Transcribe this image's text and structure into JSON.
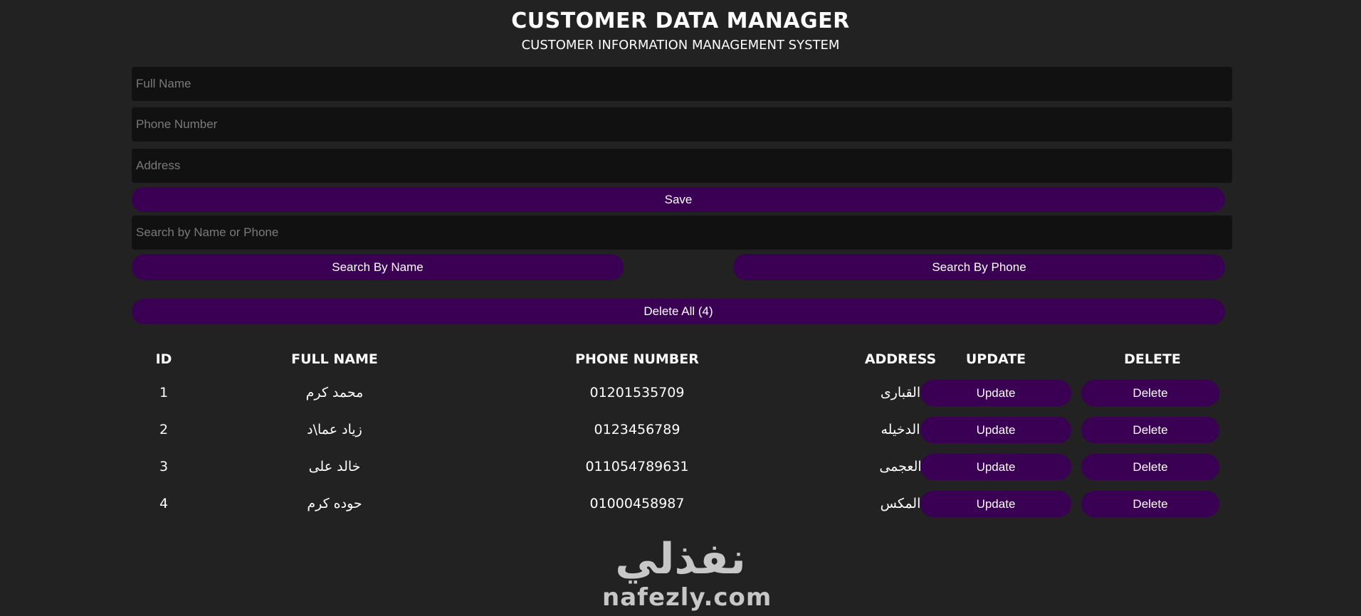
{
  "header": {
    "title": "CUSTOMER DATA MANAGER",
    "subtitle": "CUSTOMER INFORMATION MANAGEMENT SYSTEM"
  },
  "form": {
    "full_name": {
      "value": "",
      "placeholder": "Full Name"
    },
    "phone_number": {
      "value": "",
      "placeholder": "Phone Number"
    },
    "address": {
      "value": "",
      "placeholder": "Address"
    },
    "save_label": "Save"
  },
  "search": {
    "value": "",
    "placeholder": "Search by Name or Phone",
    "by_name_label": "Search By Name",
    "by_phone_label": "Search By Phone"
  },
  "delete_all_label": "Delete All (4)",
  "table": {
    "headers": {
      "id": "ID",
      "full_name": "FULL NAME",
      "phone_number": "PHONE NUMBER",
      "address": "ADDRESS",
      "update": "UPDATE",
      "delete": "DELETE"
    },
    "rows": [
      {
        "id": "1",
        "full_name": "محمد كرم",
        "phone_number": "01201535709",
        "address": "القبارى",
        "update_label": "Update",
        "delete_label": "Delete"
      },
      {
        "id": "2",
        "full_name": "زياد عما\\د",
        "phone_number": "0123456789",
        "address": "الدخيله",
        "update_label": "Update",
        "delete_label": "Delete"
      },
      {
        "id": "3",
        "full_name": "خالد على",
        "phone_number": "011054789631",
        "address": "العجمى",
        "update_label": "Update",
        "delete_label": "Delete"
      },
      {
        "id": "4",
        "full_name": "حوده كرم",
        "phone_number": "01000458987",
        "address": "المكس",
        "update_label": "Update",
        "delete_label": "Delete"
      }
    ]
  },
  "watermark": {
    "arabic": "نفذلي",
    "latin": "nafezly.com"
  },
  "colors": {
    "background": "#222222",
    "input_background": "#111111",
    "button_purple": "#3a0054",
    "text": "#ffffff",
    "placeholder": "#7a7a7a"
  }
}
